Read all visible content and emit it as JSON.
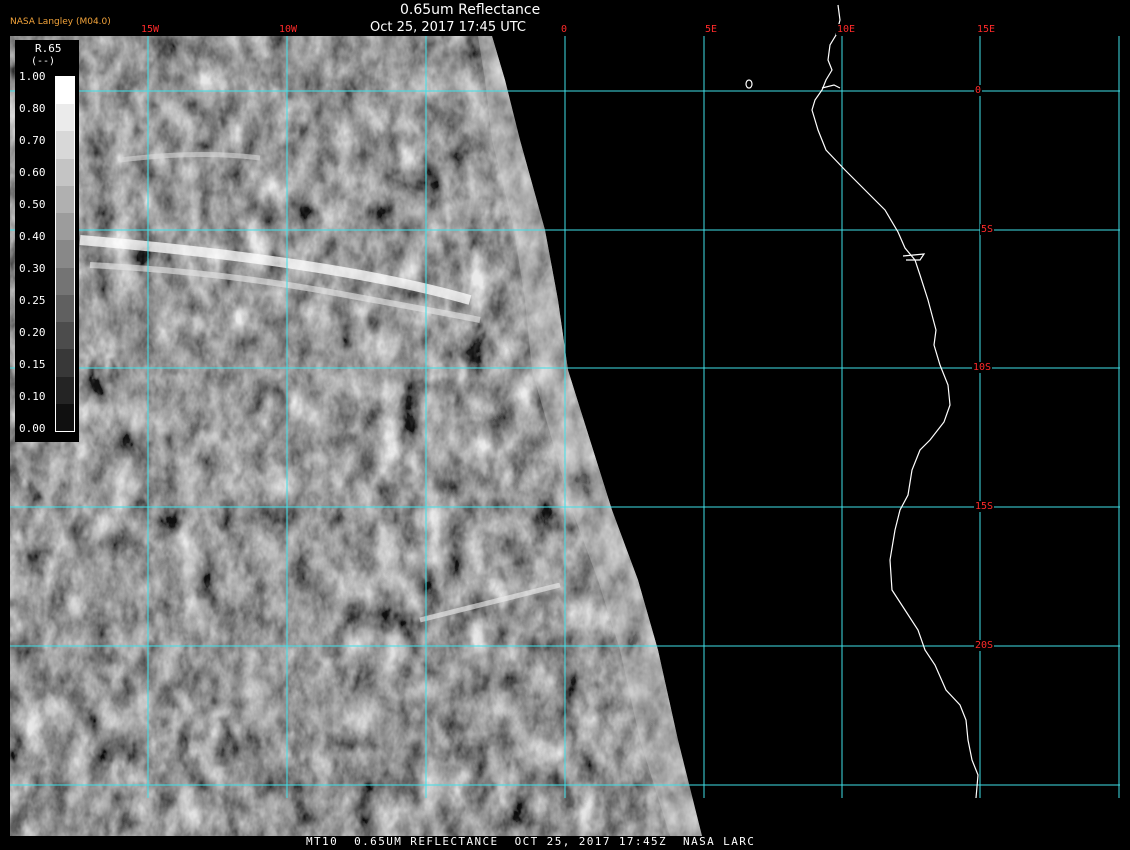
{
  "title": "0.65um Reflectance",
  "subtitle": "Oct 25, 2017 17:45 UTC",
  "brand": "NASA Langley (M04.0)",
  "footer": "MT10  0.65UM REFLECTANCE  OCT 25, 2017 17:45Z  NASA LARC",
  "legend": {
    "variable": "R.65",
    "unit": "(--)",
    "ticks": [
      "1.00",
      "0.80",
      "0.70",
      "0.60",
      "0.50",
      "0.40",
      "0.30",
      "0.25",
      "0.20",
      "0.15",
      "0.10",
      "0.00"
    ],
    "swatch_grays": [
      "#ffffff",
      "#ebebeb",
      "#d8d8d8",
      "#c4c4c4",
      "#b0b0b0",
      "#9c9c9c",
      "#888888",
      "#747474",
      "#606060",
      "#4c4c4c",
      "#383838",
      "#242424",
      "#101010"
    ]
  },
  "graticule": {
    "lon_labels": [
      "15W",
      "10W",
      "0",
      "5E",
      "10E",
      "15E"
    ],
    "lat_labels": [
      "0",
      "5S",
      "10S",
      "15S",
      "20S"
    ],
    "grid_color": "#3fe0e8",
    "label_color": "#ff2a2a"
  },
  "colors": {
    "coastline": "#ffffff",
    "background": "#000000"
  }
}
